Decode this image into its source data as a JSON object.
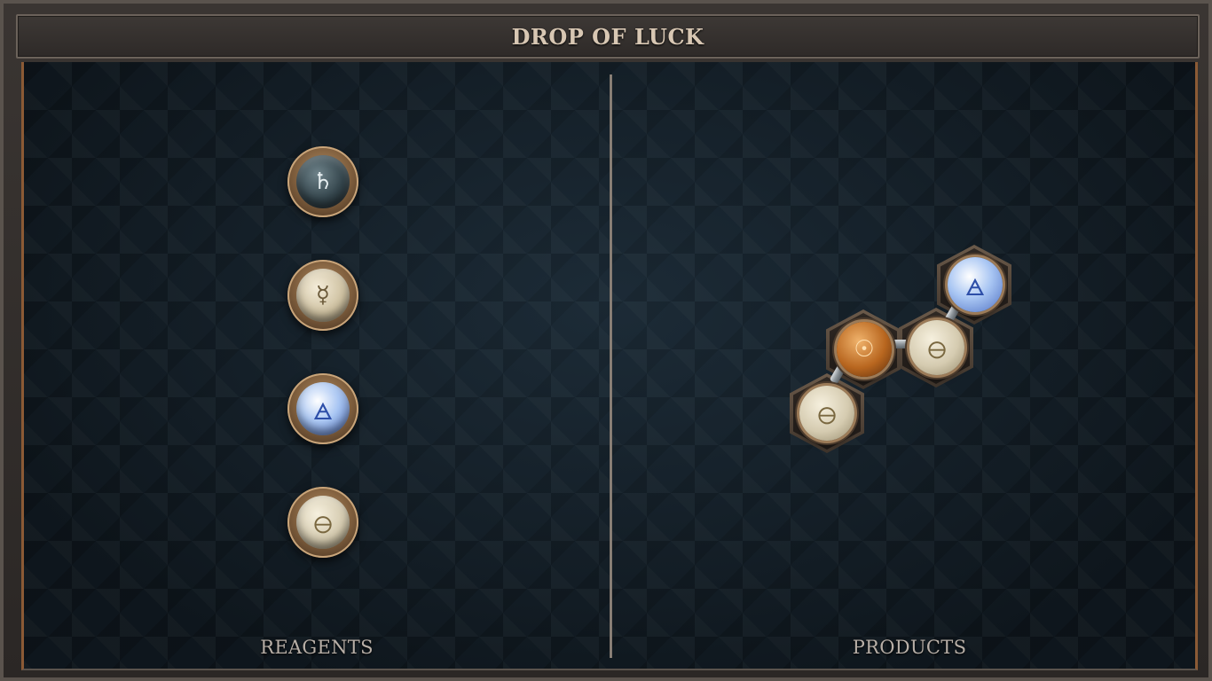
{
  "window": {
    "title": "DROP OF LUCK"
  },
  "panels": {
    "reagents_label": "REAGENTS",
    "products_label": "PRODUCTS"
  },
  "reagents": [
    {
      "element": "lead",
      "glyph": "♄",
      "icon": "lead-icon"
    },
    {
      "element": "quicksilver",
      "glyph": "☿",
      "icon": "quicksilver-icon"
    },
    {
      "element": "air",
      "glyph": "🜁",
      "icon": "air-icon"
    },
    {
      "element": "salt",
      "glyph": "🜔",
      "icon": "salt-icon"
    }
  ],
  "product": {
    "atoms": [
      {
        "element": "gold",
        "glyph": "☉",
        "icon": "gold-icon"
      },
      {
        "element": "salt",
        "glyph": "🜔",
        "icon": "salt-icon"
      },
      {
        "element": "air",
        "glyph": "🜁",
        "icon": "air-icon"
      },
      {
        "element": "salt",
        "glyph": "🜔",
        "icon": "salt-icon"
      }
    ]
  },
  "colors": {
    "frame": "#3a3532",
    "board": "#16222c",
    "accent_copper": "#8b5a35",
    "title_text": "#d8c7b3"
  }
}
